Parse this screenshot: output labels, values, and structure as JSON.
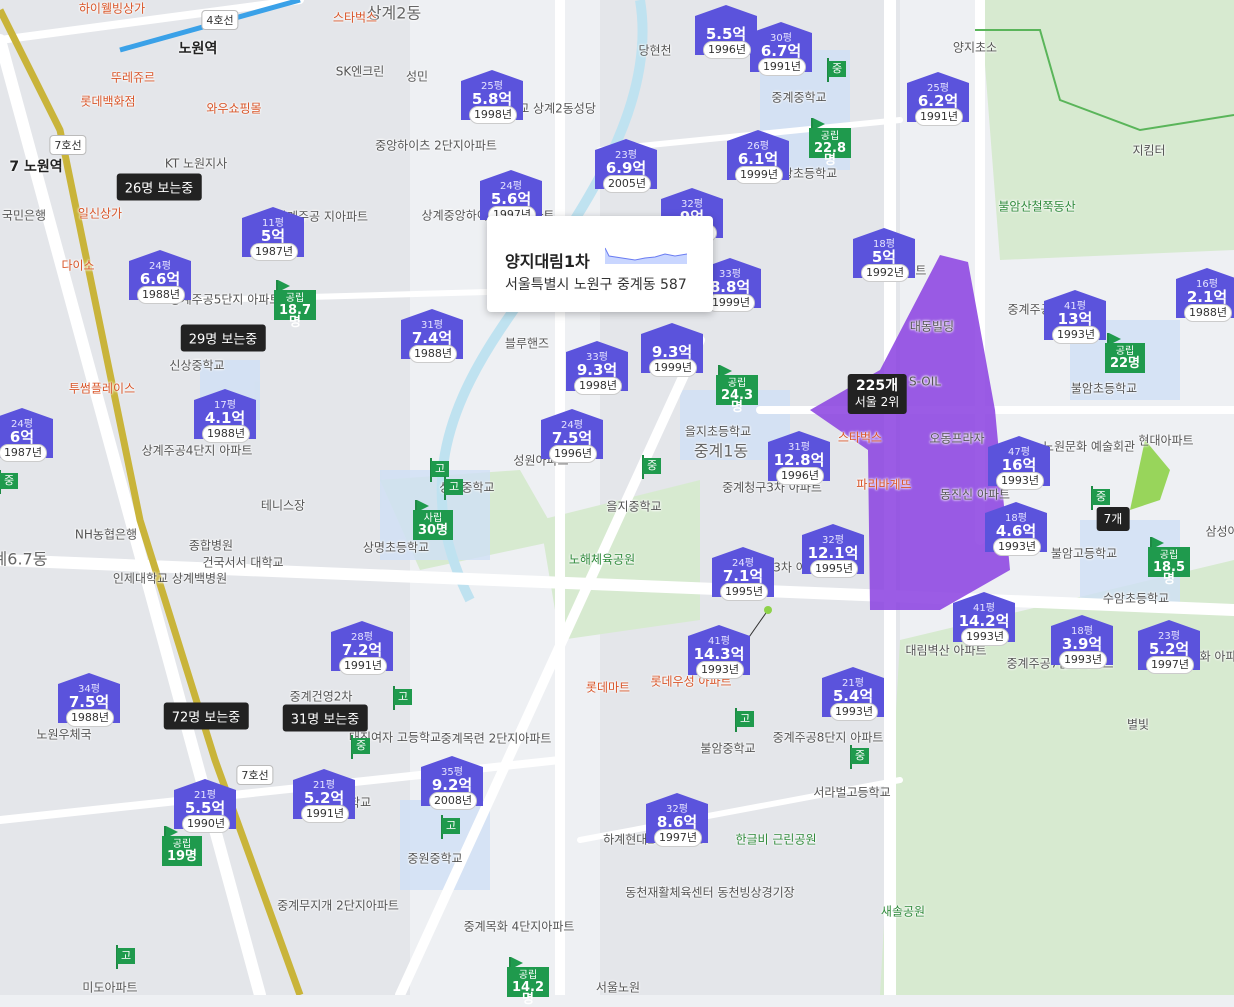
{
  "popup": {
    "title": "양지대림1차",
    "address": "서울특별시 노원구 중계동 587"
  },
  "cluster": {
    "count": "225개",
    "rank": "서울 2위"
  },
  "cluster_small": "7개",
  "viewers": [
    "26명 보는중",
    "29명 보는중",
    "72명 보는중",
    "31명 보는중"
  ],
  "stations": {
    "nowon_label": "노원역",
    "line4": "4호선",
    "line7": "7호선",
    "seven_nowon": "7 노원역"
  },
  "markers": [
    {
      "py": "25평",
      "price": "5.8억",
      "year": "1998년"
    },
    {
      "py": "30평",
      "price": "6.7억",
      "year": "1991년"
    },
    {
      "py": "25평",
      "price": "6.2억",
      "year": "1991년"
    },
    {
      "py": "23평",
      "price": "6.9억",
      "year": "2005년"
    },
    {
      "py": "24평",
      "price": "5.6억",
      "year": "1997년"
    },
    {
      "py": "26평",
      "price": "6.1억",
      "year": "1999년"
    },
    {
      "py": "32평",
      "price": "9억",
      "year": "1999년"
    },
    {
      "py": "18평",
      "price": "5억",
      "year": "1992년"
    },
    {
      "py": "11평",
      "price": "5억",
      "year": "1987년"
    },
    {
      "py": "24평",
      "price": "6.6억",
      "year": "1988년"
    },
    {
      "py": "33평",
      "price": "8.8억",
      "year": "1999년"
    },
    {
      "py": "41평",
      "price": "13억",
      "year": "1993년"
    },
    {
      "py": "16평",
      "price": "2.1억",
      "year": "1988년"
    },
    {
      "py": "31평",
      "price": "7.4억",
      "year": "1988년"
    },
    {
      "py": "33평",
      "price": "9.3억",
      "year": "1998년"
    },
    {
      "py": "",
      "price": "9.3억",
      "year": "1999년"
    },
    {
      "py": "17평",
      "price": "4.1억",
      "year": "1988년"
    },
    {
      "py": "24평",
      "price": "7.5억",
      "year": "1996년"
    },
    {
      "py": "31평",
      "price": "12.8억",
      "year": "1996년"
    },
    {
      "py": "47평",
      "price": "16억",
      "year": "1993년"
    },
    {
      "py": "24평",
      "price": "6억",
      "year": "1987년"
    },
    {
      "py": "18평",
      "price": "4.6억",
      "year": "1993년"
    },
    {
      "py": "32평",
      "price": "12.1억",
      "year": "1995년"
    },
    {
      "py": "24평",
      "price": "7.1억",
      "year": "1995년"
    },
    {
      "py": "41평",
      "price": "14.2억",
      "year": "1993년"
    },
    {
      "py": "41평",
      "price": "14.3억",
      "year": "1993년"
    },
    {
      "py": "18평",
      "price": "3.9억",
      "year": "1993년"
    },
    {
      "py": "23평",
      "price": "5.2억",
      "year": "1997년"
    },
    {
      "py": "28평",
      "price": "7.2억",
      "year": "1991년"
    },
    {
      "py": "34평",
      "price": "7.5억",
      "year": "1988년"
    },
    {
      "py": "21평",
      "price": "5.4억",
      "year": "1993년"
    },
    {
      "py": "35평",
      "price": "9.2억",
      "year": "2008년"
    },
    {
      "py": "21평",
      "price": "5.5억",
      "year": "1990년"
    },
    {
      "py": "21평",
      "price": "5.2억",
      "year": "1991년"
    },
    {
      "py": "32평",
      "price": "8.6억",
      "year": "1997년"
    },
    {
      "py": "",
      "price": "5.5억",
      "year": "1996년"
    }
  ],
  "flags": [
    {
      "kind": "공립",
      "count": "22.8명"
    },
    {
      "kind": "공립",
      "count": "18.7명"
    },
    {
      "kind": "공립",
      "count": "22명"
    },
    {
      "kind": "공립",
      "count": "24.3명"
    },
    {
      "kind": "사립",
      "count": "30명"
    },
    {
      "kind": "공립",
      "count": "18.5명"
    },
    {
      "kind": "공립",
      "count": "19명"
    },
    {
      "kind": "공립",
      "count": "14.2명"
    }
  ],
  "small_flags": [
    "중",
    "중",
    "고",
    "고",
    "중",
    "고",
    "고",
    "중",
    "고",
    "고",
    "중",
    "중"
  ],
  "labels": {
    "dong": [
      "상계2동",
      "중계1동",
      "계6.7동"
    ],
    "places": [
      "하이웰빙상가",
      "스타벅스",
      "뚜레쥬르",
      "롯데백화점",
      "와우쇼핑몰",
      "SK엔크린",
      "성민",
      "당현천",
      "천주교 상계2동성당",
      "중앙하이츠 2단지아파트",
      "상계중앙하이츠 1차아파트",
      "KT 노원지사",
      "일신상가",
      "다이소",
      "국민은행",
      "상계주공 지아파트",
      "상계주공5단지 아파트",
      "신상중학교",
      "투썸플레이스",
      "상계주공4단지 아파트",
      "블루핸즈",
      "성원아파트",
      "상원중학교",
      "을지초등학교",
      "을지중학교",
      "노해체육공원",
      "상명초등학교",
      "테니스장",
      "NH농협은행",
      "종합병원",
      "인제대학교 상계백병원",
      "건국서서 대학교",
      "중계청구3차 아파트",
      "건영3차 아파트",
      "대림벽산 아파트",
      "중계주공7단지아파트",
      "동진신 아파트",
      "오동프라자",
      "파리바게뜨",
      "스타벅스",
      "대동빌딩",
      "S-OIL",
      "노원문화 예술회관",
      "현대아파트",
      "불암초등학교",
      "불암고등학교",
      "수암초등학교",
      "중계한화 아파트",
      "삼성아",
      "중계주공 아파트",
      "5단지아파트",
      "원광초등학교",
      "중계중학교",
      "양지초소",
      "지킴터",
      "불암산철쭉동산",
      "롯데마트",
      "롯데우성 아파트",
      "중계주공8단지 아파트",
      "불암중학교",
      "서라벌고등학교",
      "한글비 근린공원",
      "하계현대2차 아파트",
      "동천재활체육센터 동천빙상경기장",
      "새솔공원",
      "중계건영2차",
      "중계목련 2단지아파트",
      "대진여자 고등학교",
      "상계초등학교",
      "중원중학교",
      "중계무지개 2단지아파트",
      "중계목화 4단지아파트",
      "서울노원",
      "미도아파트",
      "노원우체국",
      "별빛"
    ]
  }
}
